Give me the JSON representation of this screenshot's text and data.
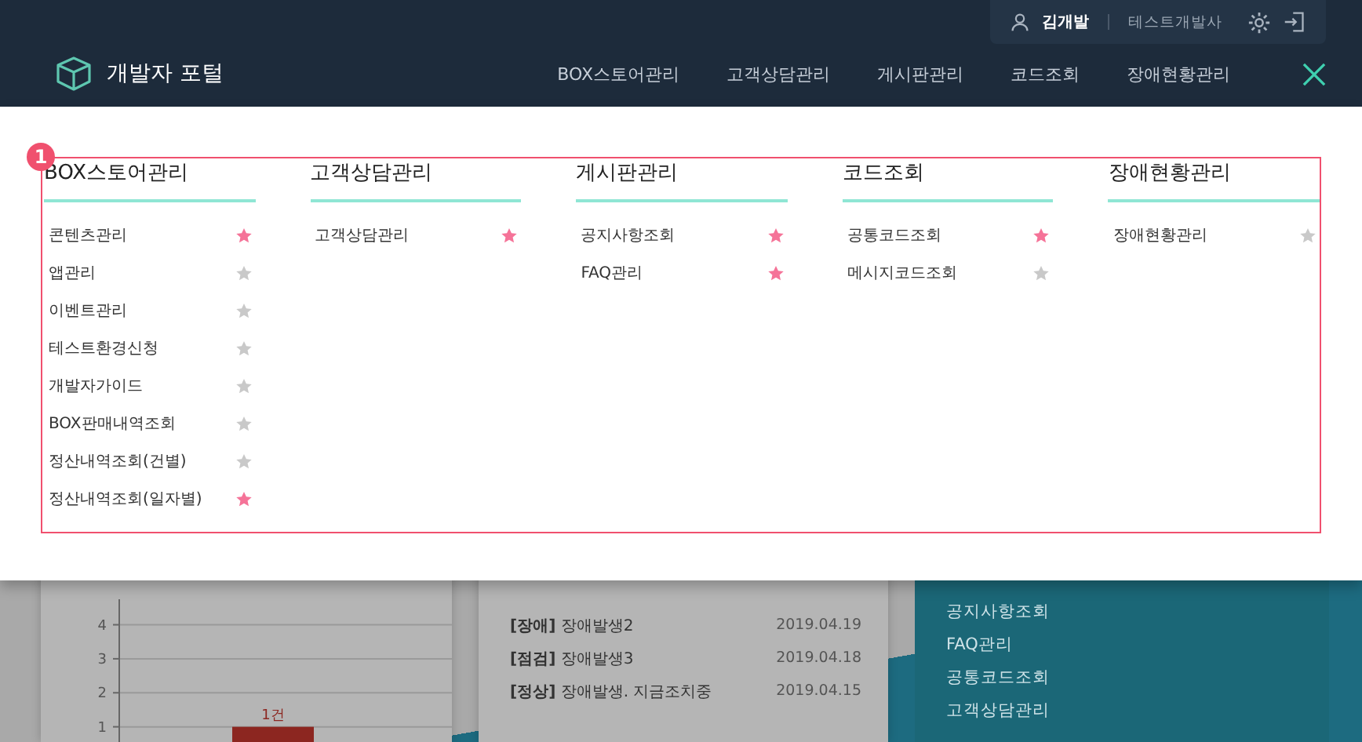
{
  "user_bar": {
    "user_name": "김개발",
    "company": "테스트개발사"
  },
  "header": {
    "title": "개발자 포털",
    "nav": [
      "BOX스토어관리",
      "고객상담관리",
      "게시판관리",
      "코드조회",
      "장애현황관리"
    ]
  },
  "menu": {
    "badge": "1",
    "columns": [
      {
        "title": "BOX스토어관리",
        "items": [
          {
            "label": "콘텐츠관리",
            "favorite": true
          },
          {
            "label": "앱관리",
            "favorite": false
          },
          {
            "label": "이벤트관리",
            "favorite": false
          },
          {
            "label": "테스트환경신청",
            "favorite": false
          },
          {
            "label": "개발자가이드",
            "favorite": false
          },
          {
            "label": "BOX판매내역조회",
            "favorite": false
          },
          {
            "label": "정산내역조회(건별)",
            "favorite": false
          },
          {
            "label": "정산내역조회(일자별)",
            "favorite": true
          }
        ]
      },
      {
        "title": "고객상담관리",
        "items": [
          {
            "label": "고객상담관리",
            "favorite": true
          }
        ]
      },
      {
        "title": "게시판관리",
        "items": [
          {
            "label": "공지사항조회",
            "favorite": true
          },
          {
            "label": "FAQ관리",
            "favorite": true
          }
        ]
      },
      {
        "title": "코드조회",
        "items": [
          {
            "label": "공통코드조회",
            "favorite": true
          },
          {
            "label": "메시지코드조회",
            "favorite": false
          }
        ]
      },
      {
        "title": "장애현황관리",
        "items": [
          {
            "label": "장애현황관리",
            "favorite": false
          }
        ]
      }
    ]
  },
  "background": {
    "chart": {
      "chart_data": {
        "type": "bar",
        "values": [
          1
        ],
        "ylim": [
          0,
          4.75
        ],
        "grid": true,
        "yticks": [
          1,
          2,
          3,
          4
        ],
        "value_labels": [
          "1건"
        ]
      }
    },
    "notices": [
      {
        "text": "**[장애]** 장애발생2",
        "date": "2019.04.19"
      },
      {
        "text": "**[점검]** 장애발생3",
        "date": "2019.04.18"
      },
      {
        "text": "**[정상]** 장애발생. 지금조치중",
        "date": "2019.04.15"
      }
    ],
    "links": [
      "공지사항조회",
      "FAQ관리",
      "공통코드조회",
      "고객상담관리"
    ]
  }
}
